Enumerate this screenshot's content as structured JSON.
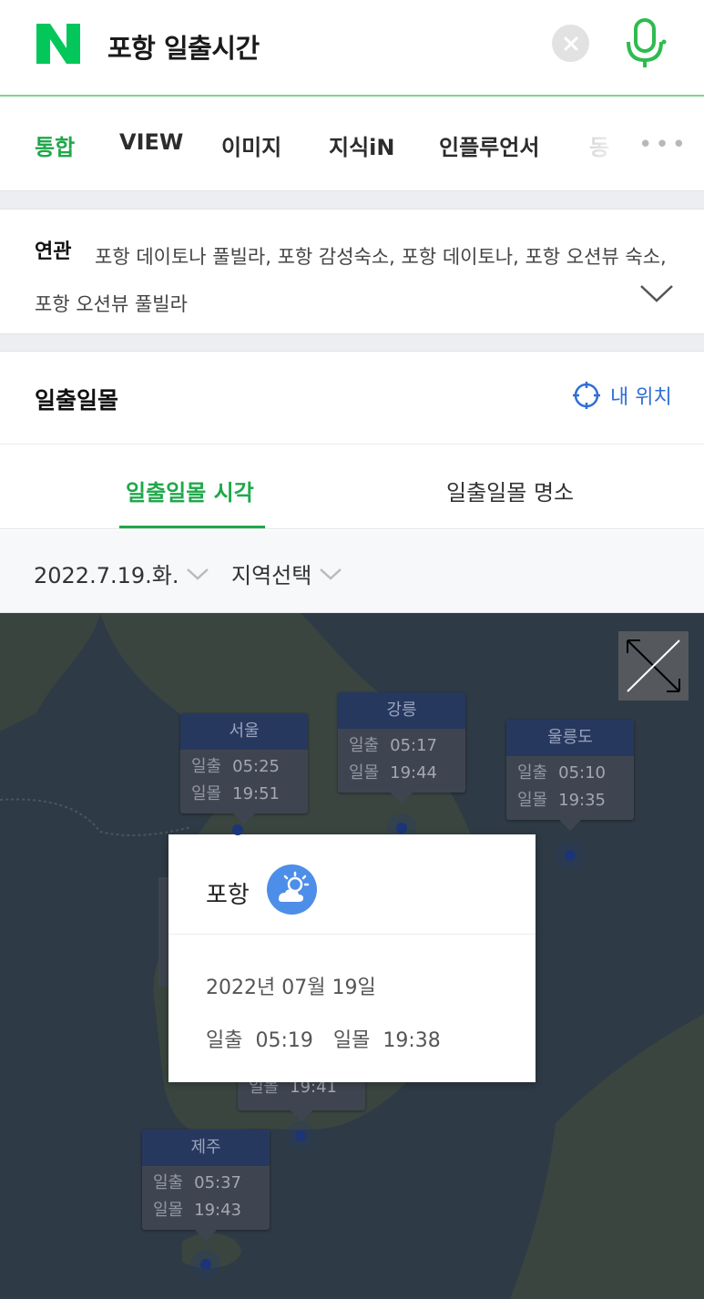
{
  "search": {
    "query": "포항 일출시간",
    "logo_letter": "N",
    "clear_icon": "close-icon",
    "mic_icon": "microphone-icon"
  },
  "tabs": [
    {
      "label": "통합",
      "active": true
    },
    {
      "label": "VIEW",
      "active": false
    },
    {
      "label": "이미지",
      "active": false
    },
    {
      "label": "지식iN",
      "active": false
    },
    {
      "label": "인플루언서",
      "active": false
    },
    {
      "label": "동",
      "active": false
    }
  ],
  "tabs_more": "•••",
  "related": {
    "label": "연관",
    "keywords": "포항 데이토나 풀빌라, 포항 감성숙소, 포항 데이토나, 포항 오션뷰 숙소, 포항 오션뷰 풀빌라"
  },
  "card": {
    "title": "일출일몰",
    "my_location": "내 위치"
  },
  "sub_tabs": [
    {
      "label": "일출일몰 시각",
      "active": true
    },
    {
      "label": "일출일몰 명소",
      "active": false
    }
  ],
  "filters": {
    "date": "2022.7.19.화.",
    "region": "지역선택"
  },
  "map": {
    "cities": [
      {
        "name": "서울",
        "sunrise_label": "일출",
        "sunrise": "05:25",
        "sunset_label": "일몰",
        "sunset": "19:51"
      },
      {
        "name": "강릉",
        "sunrise_label": "일출",
        "sunrise": "05:17",
        "sunset_label": "일몰",
        "sunset": "19:44"
      },
      {
        "name": "울릉도",
        "sunrise_label": "일출",
        "sunrise": "05:10",
        "sunset_label": "일몰",
        "sunset": "19:35"
      },
      {
        "name": "제주",
        "sunrise_label": "일출",
        "sunrise": "05:37",
        "sunset_label": "일몰",
        "sunset": "19:43"
      }
    ],
    "hidden_card": {
      "sunset_label": "일몰",
      "sunset": "19:41"
    },
    "popup": {
      "city": "포항",
      "weather_icon": "partly-cloudy-icon",
      "date": "2022년 07월 19일",
      "sunrise_label": "일출",
      "sunrise": "05:19",
      "sunset_label": "일몰",
      "sunset": "19:38"
    }
  },
  "colors": {
    "naver_green": "#03c75a",
    "active_green": "#1fa84a",
    "link_blue": "#2f6fd6",
    "map_bg": "#2e3a45"
  }
}
